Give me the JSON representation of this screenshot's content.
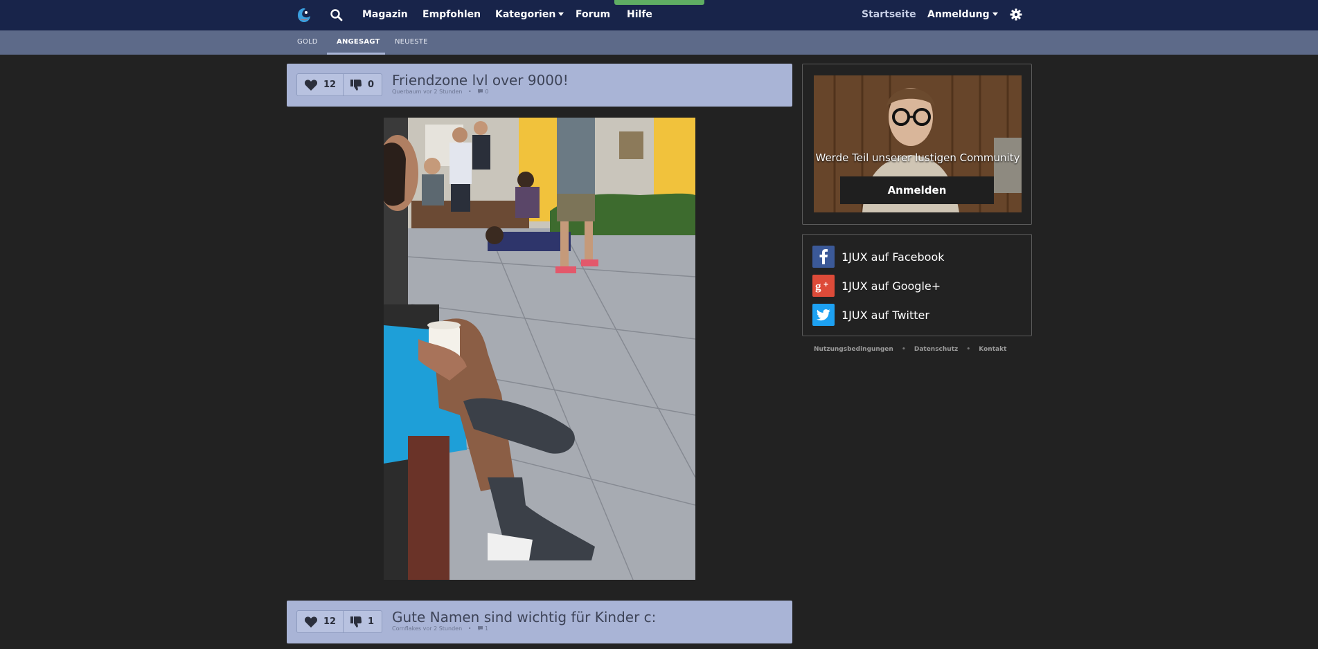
{
  "nav": {
    "items": [
      "Magazin",
      "Empfohlen",
      "Kategorien",
      "Forum",
      "Hilfe"
    ],
    "right": [
      "Startseite",
      "Anmeldung"
    ]
  },
  "subnav": {
    "tabs": [
      "GOLD",
      "ANGESAGT",
      "NEUESTE"
    ],
    "active": "ANGESAGT"
  },
  "posts": [
    {
      "title": "Friendzone lvl over 9000!",
      "likes": "12",
      "dislikes": "0",
      "author": "Querbaum",
      "time": "vor 2 Stunden",
      "comments": "0"
    },
    {
      "title": "Gute Namen sind wichtig für Kinder c:",
      "likes": "12",
      "dislikes": "1",
      "author": "Cornflakes",
      "time": "vor 2 Stunden",
      "comments": "1"
    }
  ],
  "sidebar": {
    "promo_text": "Werde Teil unserer lustigen Community",
    "promo_button": "Anmelden",
    "social": [
      {
        "label": "1JUX auf Facebook",
        "icon": "facebook-icon",
        "color": "#3b5998"
      },
      {
        "label": "1JUX auf Google+",
        "icon": "google-plus-icon",
        "color": "#dd4b39"
      },
      {
        "label": "1JUX auf Twitter",
        "icon": "twitter-icon",
        "color": "#1da1f2"
      }
    ],
    "footer_links": [
      "Nutzungsbedingungen",
      "Datenschutz",
      "Kontakt"
    ]
  },
  "colors": {
    "navbar": "#18244a",
    "subnav": "#5d6a89",
    "post_header": "#a9b4d6",
    "background": "#222222",
    "accent": "#5fae63"
  }
}
